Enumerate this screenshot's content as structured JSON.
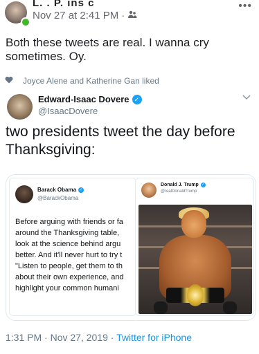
{
  "fb_post": {
    "author": "L. . P. ins c",
    "timestamp": "Nov 27 at 2:41 PM",
    "separator": "·",
    "audience_icon": "friends-icon",
    "more": "•••",
    "text": "Both these tweets are real. I wanna cry sometimes. Oy."
  },
  "tweet": {
    "liked_by": "Joyce Alene and Katherine Gan liked",
    "author_name": "Edward-Isaac Dovere",
    "author_handle": "@IsaacDovere",
    "text": "two presidents tweet the day before Thanksgiving:",
    "timestamp": "1:31 PM · Nov 27, 2019 · ",
    "source": "Twitter for iPhone",
    "accent": "#1da1f2"
  },
  "obama_tweet": {
    "name": "Barack Obama",
    "handle": "@BarackObama",
    "lines": [
      "Before arguing with friends or fa",
      "around the Thanksgiving table,",
      "look at the science behind argu",
      "better. And it'll never hurt to try t",
      "\"Listen to people, get them to th",
      "about their own experience, and",
      "highlight your common humani"
    ]
  },
  "trump_tweet": {
    "name": "Donald J. Trump",
    "handle": "@realDonaldTrump"
  }
}
